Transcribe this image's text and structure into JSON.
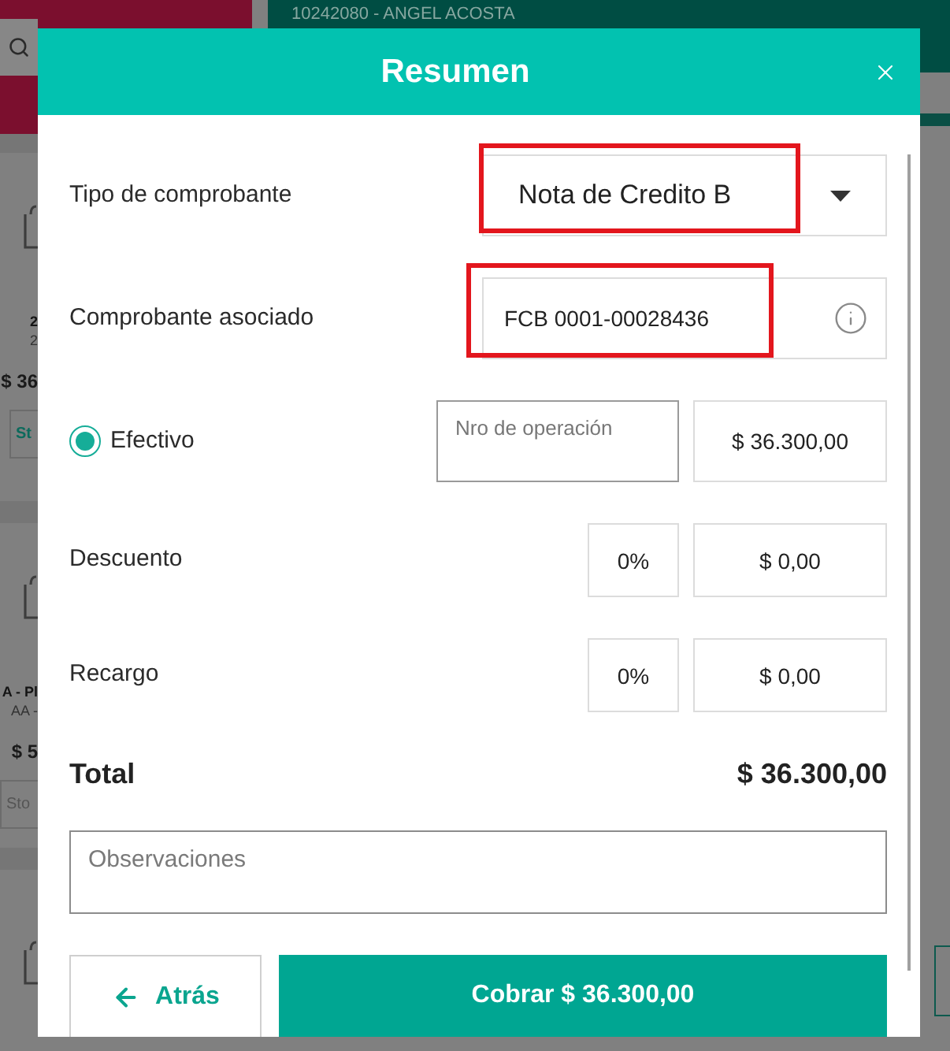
{
  "background": {
    "customer": "10242080 - ANGEL ACOSTA",
    "products": [
      {
        "name": "2",
        "code": "2",
        "price": "$ 36",
        "button": "St",
        "disabled": false
      },
      {
        "name": "A - Pl",
        "code": "AA -",
        "price": "$ 5",
        "button": "Sto",
        "disabled": true
      }
    ]
  },
  "dialog": {
    "title": "Resumen",
    "fields": [
      {
        "kind": "select",
        "label": "Tipo de comprobante",
        "value": "Nota de Credito B",
        "highlighted": true
      },
      {
        "kind": "info",
        "label": "Comprobante asociado",
        "value": "FCB 0001-00028436",
        "highlighted": true
      },
      {
        "kind": "payment",
        "label": "Efectivo",
        "selected": true,
        "placeholder": "Nro de operación",
        "amount": "$ 36.300,00"
      },
      {
        "kind": "adjust",
        "label": "Descuento",
        "percent": "0%",
        "amount": "$ 0,00"
      },
      {
        "kind": "adjust",
        "label": "Recargo",
        "percent": "0%",
        "amount": "$ 0,00"
      }
    ],
    "total": {
      "label": "Total",
      "amount": "$ 36.300,00"
    },
    "notes": {
      "placeholder": "Observaciones"
    },
    "buttons": [
      {
        "kind": "back",
        "label": "Atrás"
      },
      {
        "kind": "primary",
        "label": "Cobrar $ 36.300,00"
      }
    ]
  }
}
